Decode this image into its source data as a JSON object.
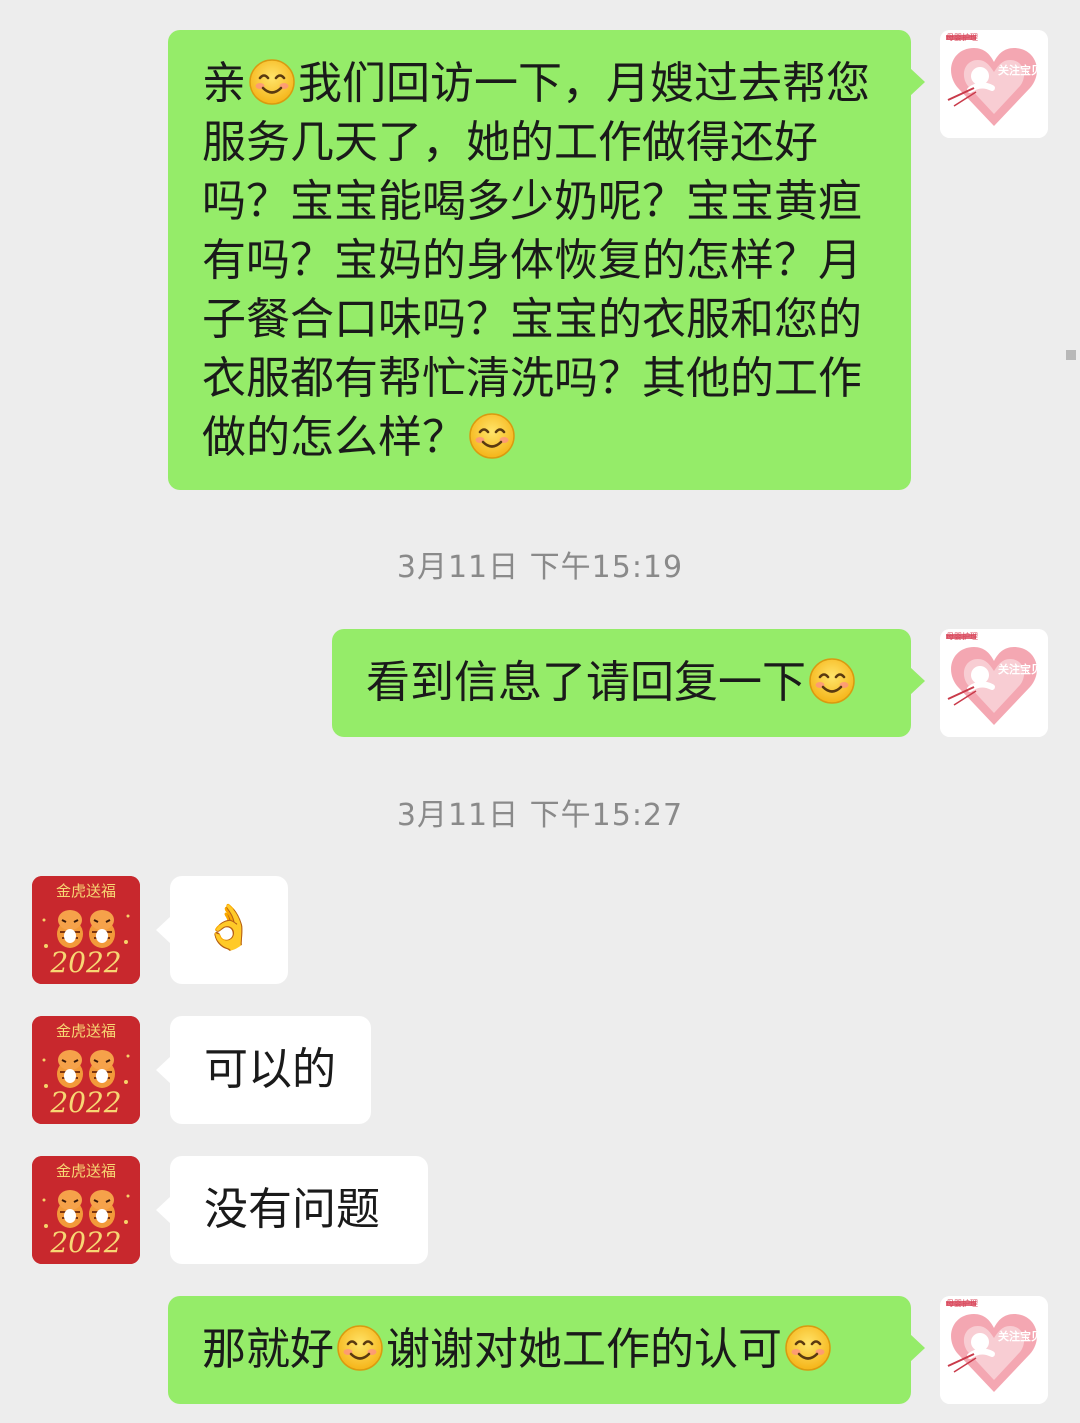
{
  "messages": {
    "m1": {
      "t1": "亲",
      "t2": "我们回访一下，月嫂过去帮您",
      "t3": "服务几天了，她的工作做得还好",
      "t4": "吗？宝宝能喝多少奶呢？宝宝黄疸",
      "t5": "有吗？宝妈的身体恢复的怎样？月",
      "t6": "子餐合口味吗？宝宝的衣服和您的",
      "t7": "衣服都有帮忙清洗吗？其他的工作",
      "t8": "做的怎么样？"
    },
    "ts1": "3月11日 下午15:19",
    "m2": {
      "text": "看到信息了请回复一下"
    },
    "ts2": "3月11日 下午15:27",
    "m3": {
      "emoji": "👌"
    },
    "m4": {
      "text": "可以的"
    },
    "m5": {
      "text": "没有问题"
    },
    "m6": {
      "t1": "那就好",
      "t2": "谢谢对她工作的认可"
    }
  },
  "avatars": {
    "self_small_text": "母婴护理",
    "self_text": "关注宝贝",
    "other_text_top": "金虎送福",
    "other_year": "2022"
  },
  "colors": {
    "background": "#ededed",
    "outgoing_bubble": "#95ec69",
    "incoming_bubble": "#ffffff",
    "timestamp": "#8a8a8a",
    "other_avatar": "#c8282d"
  },
  "icons": {
    "smile": "smiling-face-emoji",
    "ok": "ok-hand-emoji"
  }
}
